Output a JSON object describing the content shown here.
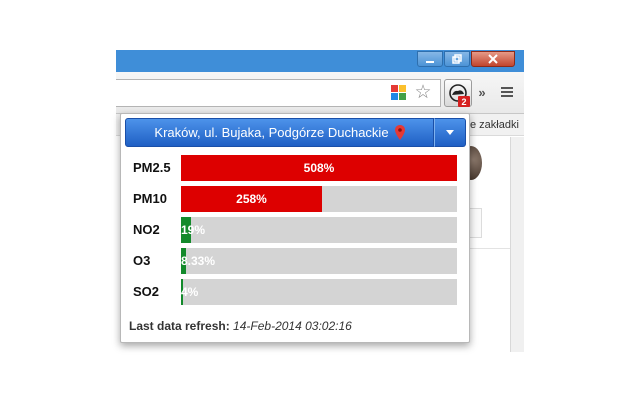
{
  "browser": {
    "bookmarks_fragment": "e zakładki",
    "badge_count": "2",
    "more_chevron": "»"
  },
  "popup": {
    "location": "Kraków, ul. Bujaka, Podgórze Duchackie",
    "refresh_label": "Last data refresh:",
    "refresh_time": "14-Feb-2014 03:02:16",
    "rows": [
      {
        "label": "PM2.5",
        "value_text": "508%",
        "fill_fraction": 1.0,
        "color": "#dd0000"
      },
      {
        "label": "PM10",
        "value_text": "258%",
        "fill_fraction": 0.511,
        "color": "#dd0000"
      },
      {
        "label": "NO2",
        "value_text": "19%",
        "fill_fraction": 0.036,
        "color": "#138a2b"
      },
      {
        "label": "O3",
        "value_text": "8.33%",
        "fill_fraction": 0.018,
        "color": "#138a2b"
      },
      {
        "label": "SO2",
        "value_text": "4%",
        "fill_fraction": 0.007,
        "color": "#138a2b"
      }
    ]
  },
  "colors": {
    "accent_blue": "#2b6fd4",
    "danger_red": "#dd0000",
    "ok_green": "#138a2b",
    "track_gray": "#d4d4d4"
  }
}
